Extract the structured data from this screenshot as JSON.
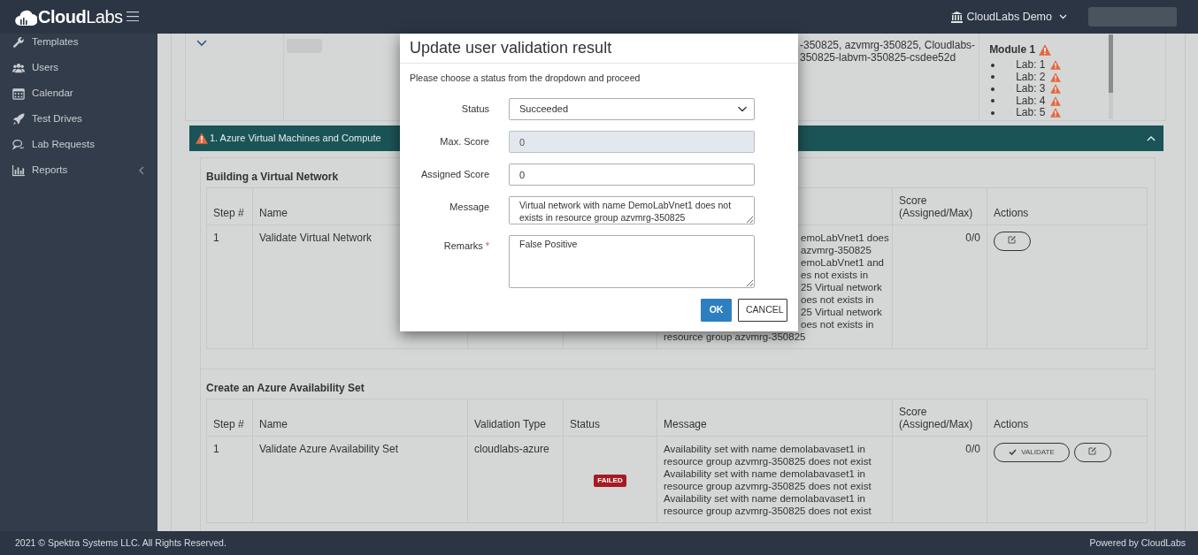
{
  "navbar": {
    "brand": "**Cloud**Labs",
    "account": "CloudLabs Demo"
  },
  "sidebar": {
    "items": [
      {
        "label": "Templates",
        "has_submenu": false
      },
      {
        "label": "Users",
        "has_submenu": false
      },
      {
        "label": "Calendar",
        "has_submenu": false
      },
      {
        "label": "Test Drives",
        "has_submenu": false
      },
      {
        "label": "Lab Requests",
        "has_submenu": false
      },
      {
        "label": "Reports",
        "has_submenu": true
      }
    ]
  },
  "top_row": {
    "expanded": false,
    "resources": [
      "-350825, azvmrg-350825, Cloudlabs-",
      "350825-labvm-350825-csdee52d"
    ],
    "module": {
      "title": "Module 1",
      "warning": true,
      "labs": [
        {
          "label": "Lab: 1",
          "warning": true
        },
        {
          "label": "Lab: 2",
          "warning": true
        },
        {
          "label": "Lab: 3",
          "warning": true
        },
        {
          "label": "Lab: 4",
          "warning": true
        },
        {
          "label": "Lab: 5",
          "warning": true
        }
      ]
    }
  },
  "section": {
    "title": "1. Azure Virtual Machines and Compute",
    "warning": true,
    "expanded": true,
    "groups": [
      {
        "title": "Building a Virtual Network",
        "columns": [
          {
            "kind": "step",
            "label": "Step #"
          },
          {
            "kind": "name",
            "label": "Name"
          },
          {
            "kind": "score",
            "label": "Score (Assigned/Max)"
          },
          {
            "kind": "actions",
            "label": "Actions"
          }
        ],
        "rows": [
          {
            "step": "1",
            "name": "Validate Virtual Network",
            "message_fragments": [
              "emoLabVnet1 does",
              "azvmrg-350825",
              "emoLabVnet1 and",
              "es not exists in",
              "25 Virtual network",
              "oes not exists in",
              "25 Virtual network",
              "oes not exists in"
            ],
            "message_lines": [
              "resource group azvmrg-350825"
            ],
            "score": "0/0",
            "actions": [
              {
                "kind": "edit"
              }
            ]
          }
        ]
      },
      {
        "title": "Create an Azure Availability Set",
        "columns": [
          {
            "kind": "step",
            "label": "Step #"
          },
          {
            "kind": "name",
            "label": "Name"
          },
          {
            "kind": "validation_type",
            "label": "Validation Type"
          },
          {
            "kind": "status",
            "label": "Status"
          },
          {
            "kind": "message",
            "label": "Message"
          },
          {
            "kind": "score",
            "label": "Score (Assigned/Max)"
          },
          {
            "kind": "actions",
            "label": "Actions"
          }
        ],
        "rows": [
          {
            "step": "1",
            "name": "Validate Azure Availability Set",
            "validation_type": "cloudlabs-azure",
            "status": {
              "label": "FAILED",
              "kind": "failed"
            },
            "message_lines": [
              "Availability set with name demolabavaset1 in resource group azvmrg-350825 does not exist",
              "Availability set with name demolabavaset1 in resource group azvmrg-350825 does not exist",
              "Availability set with name demolabavaset1 in resource group azvmrg-350825 does not exist"
            ],
            "score": "0/0",
            "actions": [
              {
                "kind": "validate",
                "label": "VALIDATE"
              },
              {
                "kind": "edit"
              }
            ]
          }
        ]
      }
    ]
  },
  "modal": {
    "title": "Update user validation result",
    "instruction": "Please choose a status from the dropdown and proceed",
    "fields": [
      {
        "kind": "select",
        "label": "Status",
        "value": "Succeeded",
        "disabled": false
      },
      {
        "kind": "input",
        "label": "Max. Score",
        "value": "0",
        "disabled": true
      },
      {
        "kind": "input",
        "label": "Assigned Score",
        "value": "0",
        "disabled": false
      },
      {
        "kind": "textarea",
        "label": "Message",
        "value": "Virtual network with name DemoLabVnet1 does not exists in resource group azvmrg-350825",
        "disabled": false
      },
      {
        "kind": "textarea",
        "label": "Remarks",
        "value": "False Positive",
        "disabled": false,
        "required_mark": "*"
      }
    ],
    "buttons": [
      {
        "kind": "primary",
        "label": "OK"
      },
      {
        "kind": "secondary",
        "label": "CANCEL"
      }
    ]
  },
  "footer": {
    "copyright": "2021 © Spektra Systems LLC. All Rights Reserved.",
    "powered_by": "Powered by CloudLabs"
  }
}
